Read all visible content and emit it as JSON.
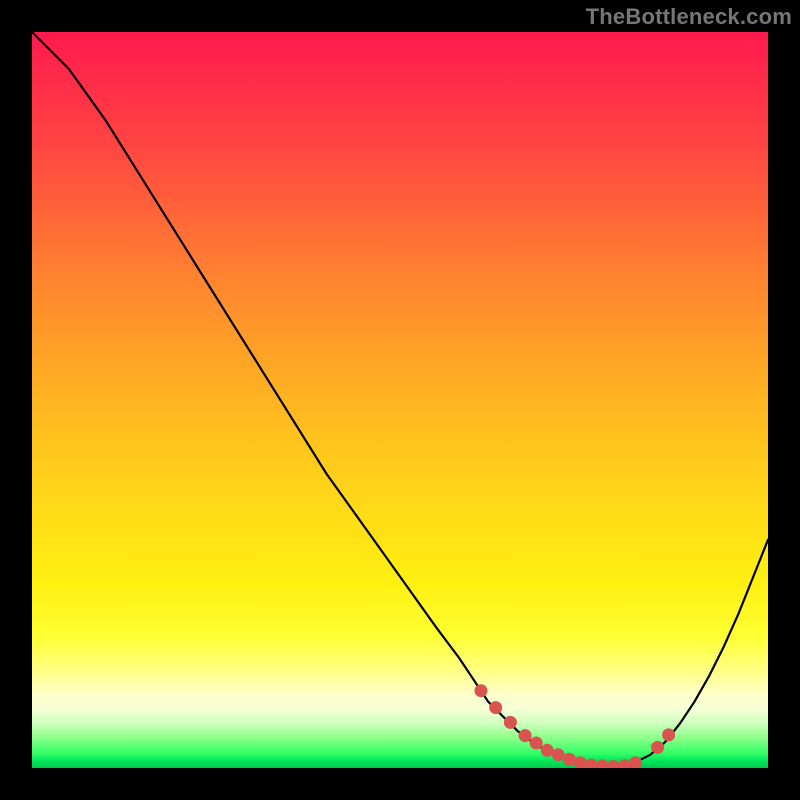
{
  "watermark": "TheBottleneck.com",
  "chart_data": {
    "type": "line",
    "title": "",
    "xlabel": "",
    "ylabel": "",
    "xlim": [
      0,
      100
    ],
    "ylim": [
      0,
      100
    ],
    "series": [
      {
        "name": "bottleneck-curve",
        "x": [
          0,
          5,
          10,
          15,
          20,
          25,
          30,
          35,
          40,
          45,
          50,
          55,
          58,
          60,
          62,
          64,
          66,
          68,
          70,
          72,
          74,
          76,
          78,
          80,
          82,
          84,
          86,
          88,
          90,
          92,
          94,
          96,
          98,
          100
        ],
        "y": [
          100,
          95,
          88,
          80,
          72,
          64,
          56,
          48,
          40,
          33,
          26,
          19,
          15,
          12,
          9,
          7,
          5,
          3.5,
          2.3,
          1.4,
          0.8,
          0.4,
          0.2,
          0.3,
          0.8,
          1.8,
          3.5,
          6,
          9,
          12.5,
          16.5,
          21,
          26,
          31
        ]
      }
    ],
    "markers": {
      "name": "highlight-dots",
      "color": "#d9534f",
      "points_x": [
        61,
        63,
        65,
        67,
        68.5,
        70,
        71.5,
        73,
        74.5,
        76,
        77.5,
        79,
        80.5,
        82,
        85,
        86.5
      ],
      "points_y": [
        10.5,
        8.2,
        6.2,
        4.4,
        3.4,
        2.4,
        1.8,
        1.2,
        0.7,
        0.4,
        0.3,
        0.2,
        0.3,
        0.7,
        2.8,
        4.5
      ]
    },
    "background_gradient_stops": [
      {
        "pos": 0,
        "color": "#ff1a4d"
      },
      {
        "pos": 50,
        "color": "#ffb022"
      },
      {
        "pos": 80,
        "color": "#ffff33"
      },
      {
        "pos": 100,
        "color": "#00c84a"
      }
    ]
  }
}
